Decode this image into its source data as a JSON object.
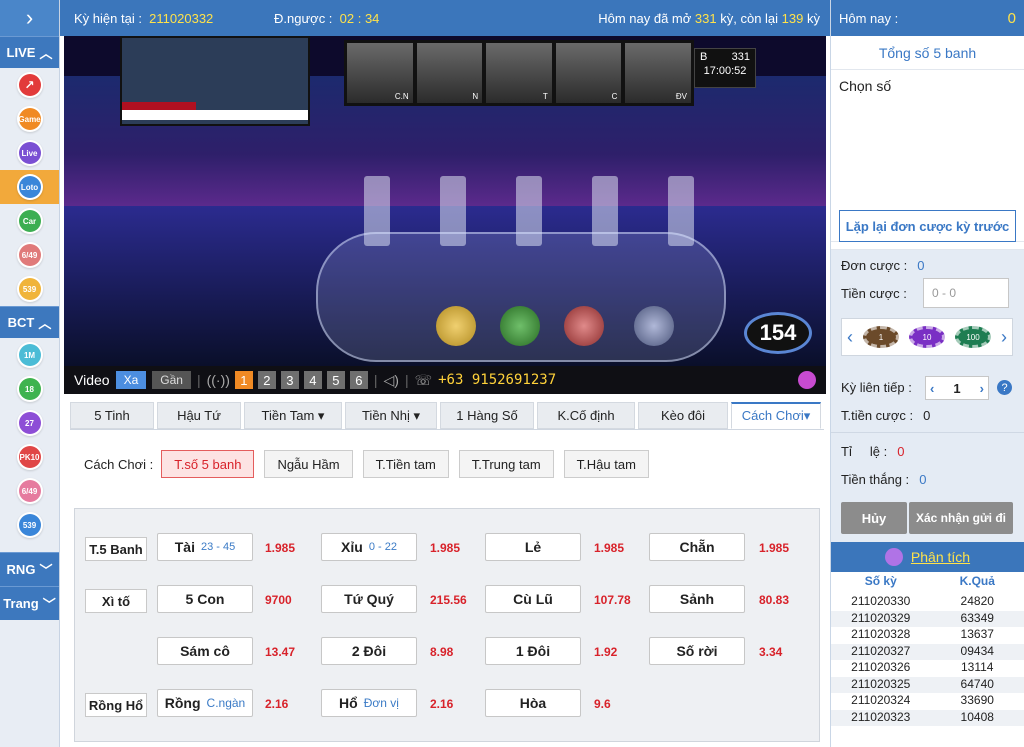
{
  "topbar": {
    "ky_label": "Kỳ hiện tại :",
    "ky_value": "211020332",
    "countdown_label": "Đ.ngược :",
    "countdown_value": "02 : 34",
    "status_prefix": "Hôm nay đã mở",
    "opened": "331",
    "status_mid": "kỳ, còn lại",
    "remaining": "139",
    "status_suffix": "kỳ"
  },
  "sidebar": {
    "sections": [
      {
        "label": "LIVE",
        "items": [
          "trend-icon",
          "Game",
          "Live",
          "Loto",
          "Car",
          "6/49",
          "539"
        ]
      },
      {
        "label": "BCT",
        "items": [
          "1M",
          "18",
          "27",
          "PK10",
          "6/49",
          "539"
        ]
      },
      {
        "label": "RNG"
      },
      {
        "label": "Trang"
      }
    ]
  },
  "video": {
    "clock_letter": "B",
    "clock_round": "331",
    "clock_time": "17:00:52",
    "slot_labels": [
      "C.N",
      "N",
      "T",
      "C",
      "ĐV"
    ],
    "ball_count": "154",
    "controls": {
      "label": "Video",
      "xa": "Xa",
      "gan": "Gần",
      "cams": [
        "1",
        "2",
        "3",
        "4",
        "5",
        "6"
      ],
      "phone": "+63 9152691237"
    }
  },
  "tabs": [
    "5 Tinh",
    "Hậu Tứ",
    "Tiền Tam ▾",
    "Tiền Nhị ▾",
    "1 Hàng Số",
    "K.Cố định",
    "Kèo đôi",
    "Cách Chơi▾"
  ],
  "mode": {
    "label": "Cách Chơi :",
    "options": [
      "T.số 5 banh",
      "Ngẫu Hầm",
      "T.Tiền tam",
      "T.Trung tam",
      "T.Hậu tam"
    ]
  },
  "grid": {
    "row1": {
      "label": "T.5 Banh",
      "bets": [
        {
          "name": "Tài",
          "sub": "23 - 45",
          "odd": "1.985"
        },
        {
          "name": "Xỉu",
          "sub": "0 - 22",
          "odd": "1.985"
        },
        {
          "name": "Lẻ",
          "sub": "",
          "odd": "1.985"
        },
        {
          "name": "Chẵn",
          "sub": "",
          "odd": "1.985"
        }
      ]
    },
    "row2": {
      "label": "Xì tố",
      "bets": [
        {
          "name": "5 Con",
          "odd": "9700"
        },
        {
          "name": "Tứ Quý",
          "odd": "215.56"
        },
        {
          "name": "Cù Lũ",
          "odd": "107.78"
        },
        {
          "name": "Sảnh",
          "odd": "80.83"
        }
      ]
    },
    "row3": {
      "bets": [
        {
          "name": "Sám cô",
          "odd": "13.47"
        },
        {
          "name": "2 Đôi",
          "odd": "8.98"
        },
        {
          "name": "1 Đôi",
          "odd": "1.92"
        },
        {
          "name": "Số rời",
          "odd": "3.34"
        }
      ]
    },
    "row4": {
      "label": "Rồng Hổ",
      "bets": [
        {
          "name": "Rồng",
          "sub": "C.ngàn",
          "odd": "2.16"
        },
        {
          "name": "Hổ",
          "sub": "Đơn vị",
          "odd": "2.16"
        },
        {
          "name": "Hòa",
          "sub": "",
          "odd": "9.6"
        }
      ]
    }
  },
  "right": {
    "today_label": "Hôm nay :",
    "today_value": "0",
    "total": "Tổng số 5 banh",
    "pick": "Chọn số",
    "repeat": "Lặp lại đơn cược kỳ trước",
    "don_cuoc_label": "Đơn cược :",
    "don_cuoc_value": "0",
    "tien_cuoc_label": "Tiền cược :",
    "tien_cuoc_placeholder": "0 - 0",
    "chips": [
      "1",
      "10",
      "100"
    ],
    "ky_lien_label": "Kỳ liên tiếp :",
    "ky_lien_value": "1",
    "t_tien_label": "T.tiền cược :",
    "t_tien_value": "0",
    "ti_le_label": "Tỉ     lệ :",
    "ti_le_value": "0",
    "tien_thang_label": "Tiền thắng :",
    "tien_thang_value": "0",
    "huy": "Hủy",
    "confirm": "Xác nhận gửi đi",
    "analysis": "Phân tích",
    "results_headers": [
      "Số kỳ",
      "K.Quả"
    ],
    "results": [
      [
        "211020330",
        "24820"
      ],
      [
        "211020329",
        "63349"
      ],
      [
        "211020328",
        "13637"
      ],
      [
        "211020327",
        "09434"
      ],
      [
        "211020326",
        "13114"
      ],
      [
        "211020325",
        "64740"
      ],
      [
        "211020324",
        "33690"
      ],
      [
        "211020323",
        "10408"
      ]
    ]
  },
  "colors": {
    "header_blue": "#3b76bb",
    "accent_yellow": "#ffe24a",
    "odd_red": "#d8222a",
    "link_blue": "#3a78c5",
    "active_orange": "#f2a93b"
  }
}
